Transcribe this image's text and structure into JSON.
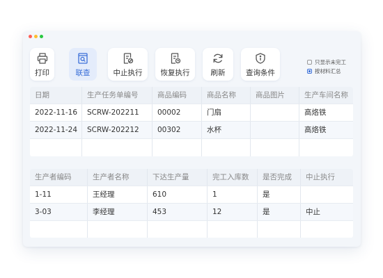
{
  "toolbar": {
    "buttons": [
      {
        "label": "打印",
        "icon": "printer-icon"
      },
      {
        "label": "联查",
        "icon": "document-search-icon"
      },
      {
        "label": "中止执行",
        "icon": "document-stop-icon"
      },
      {
        "label": "恢复执行",
        "icon": "document-restore-icon"
      },
      {
        "label": "刷新",
        "icon": "refresh-icon"
      },
      {
        "label": "查询条件",
        "icon": "info-shield-icon"
      }
    ],
    "active_button": "联查"
  },
  "options": {
    "only_unfinished": {
      "label": "只显示未完工",
      "checked": false
    },
    "summarize_by_material": {
      "label": "按材料汇总",
      "checked": true
    }
  },
  "top_table": {
    "columns": [
      "日期",
      "生产任务单编号",
      "商品编码",
      "商品名称",
      "商品图片",
      "生产车间名称"
    ],
    "rows": [
      [
        "2022-11-16",
        "SCRW-202211",
        "00002",
        "门扇",
        "",
        "高烙铁"
      ],
      [
        "2022-11-24",
        "SCRW-202212",
        "00302",
        "水杯",
        "",
        "高烙铁"
      ]
    ]
  },
  "bottom_table": {
    "columns": [
      "生产者编码",
      "生产者名称",
      "下达生产量",
      "完工入库数",
      "是否完成",
      "中止执行"
    ],
    "rows": [
      [
        "1-11",
        "王经理",
        "610",
        "1",
        "是",
        ""
      ],
      [
        "3-03",
        "李经理",
        "453",
        "12",
        "是",
        "中止"
      ]
    ]
  },
  "colors": {
    "accent": "#3a6fd8",
    "active_button_bg": "#e4ecfb",
    "window_bg": "#f3f6fa"
  }
}
